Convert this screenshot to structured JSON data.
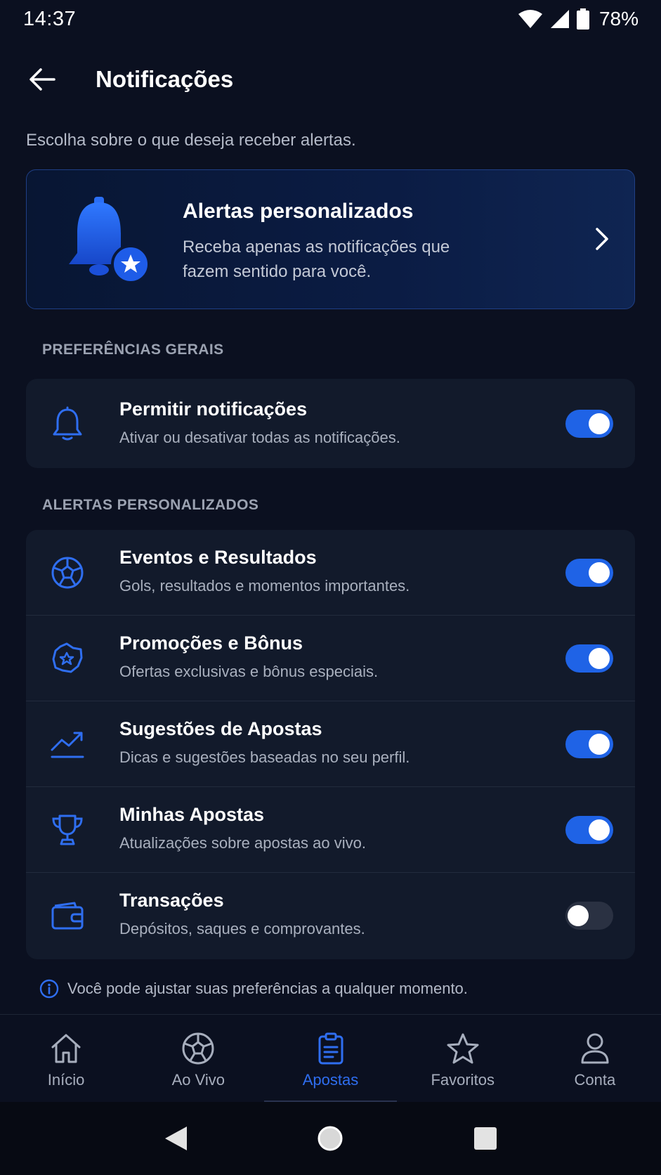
{
  "status_bar": {
    "time": "14:37",
    "battery": "78%"
  },
  "header": {
    "title": "Notificações",
    "back_icon": "arrow-left-icon"
  },
  "subtitle": "Escolha sobre o que deseja receber alertas.",
  "promo": {
    "title": "Alertas personalizados",
    "description": "Receba apenas as notificações que fazem sentido para você.",
    "icon": "bell-star-icon"
  },
  "sections": {
    "general_label": "PREFERÊNCIAS GERAIS",
    "custom_label": "ALERTAS PERSONALIZADOS"
  },
  "general": {
    "title": "Permitir notificações",
    "description": "Ativar ou desativar todas as notificações.",
    "enabled": true,
    "icon": "bell-icon"
  },
  "alerts": [
    {
      "title": "Eventos e Resultados",
      "description": "Gols, resultados e momentos importantes.",
      "enabled": true,
      "icon": "soccer-ball-icon"
    },
    {
      "title": "Promoções e Bônus",
      "description": "Ofertas exclusivas e bônus especiais.",
      "enabled": true,
      "icon": "badge-star-icon"
    },
    {
      "title": "Sugestões de Apostas",
      "description": "Dicas e sugestões baseadas no seu perfil.",
      "enabled": true,
      "icon": "trend-up-icon"
    },
    {
      "title": "Minhas Apostas",
      "description": "Atualizações sobre apostas ao vivo.",
      "enabled": true,
      "icon": "trophy-icon"
    },
    {
      "title": "Transações",
      "description": "Depósitos, saques e comprovantes.",
      "enabled": false,
      "icon": "wallet-icon"
    }
  ],
  "info_text": "Você pode ajustar suas preferências a qualquer momento.",
  "bottom_nav": [
    {
      "label": "Início",
      "icon": "home-icon",
      "active": false
    },
    {
      "label": "Ao Vivo",
      "icon": "soccer-ball-icon",
      "active": false
    },
    {
      "label": "Apostas",
      "icon": "clipboard-icon",
      "active": true
    },
    {
      "label": "Favoritos",
      "icon": "star-icon",
      "active": false
    },
    {
      "label": "Conta",
      "icon": "user-icon",
      "active": false
    }
  ],
  "colors": {
    "accent": "#1f63e6",
    "background": "#0b1020",
    "card": "#121a2b",
    "toggle_off": "#2a3142"
  }
}
